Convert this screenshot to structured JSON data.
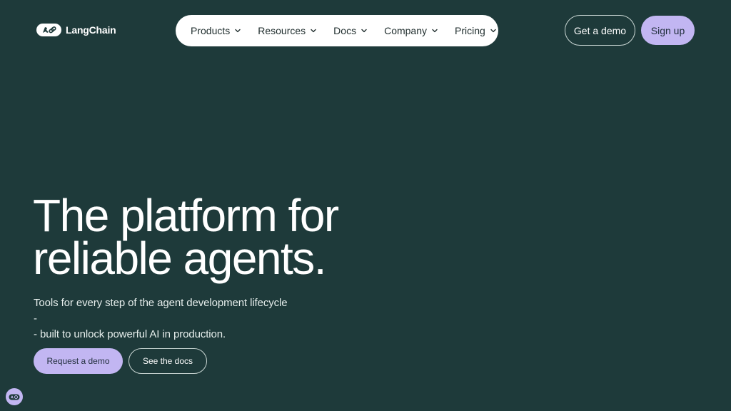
{
  "brand": {
    "name": "LangChain",
    "logo_icon": "langchain-parrot-link-icon"
  },
  "nav": {
    "items": [
      {
        "label": "Products",
        "icon": "chevron-down-icon"
      },
      {
        "label": "Resources",
        "icon": "chevron-down-icon"
      },
      {
        "label": "Docs",
        "icon": "chevron-down-icon"
      },
      {
        "label": "Company",
        "icon": "chevron-down-icon"
      },
      {
        "label": "Pricing",
        "icon": "chevron-down-icon"
      }
    ]
  },
  "header_actions": {
    "demo_label": "Get a demo",
    "signup_label": "Sign up"
  },
  "hero": {
    "title_line1": "The platform for",
    "title_line2": "reliable agents.",
    "subtitle_line1": "Tools for every step of the agent development lifecycle -",
    "subtitle_line2": "- built to unlock powerful AI in production.",
    "primary_cta": "Request a demo",
    "secondary_cta": "See the docs"
  },
  "widget": {
    "icon": "langchain-chat-widget-icon"
  },
  "colors": {
    "background": "#1e3a3a",
    "accent": "#c2b6f2",
    "nav_bg": "#ffffff",
    "text_light": "#ffffff",
    "text_dark": "#1f2d2d"
  }
}
